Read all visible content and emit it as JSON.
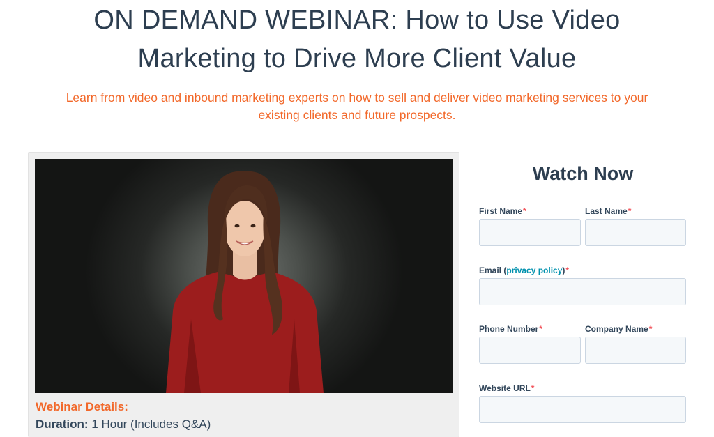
{
  "header": {
    "title_line1": "ON DEMAND WEBINAR: How to Use Video",
    "title_line2": "Marketing to Drive More Client Value",
    "subtitle_line1": "Learn from video and inbound marketing experts on how to sell and deliver video marketing services to your",
    "subtitle_line2": "existing clients and future prospects."
  },
  "webinar": {
    "details_heading": "Webinar Details:",
    "duration_label": "Duration:",
    "duration_value": "1 Hour (Includes Q&A)"
  },
  "form": {
    "title": "Watch Now",
    "required_mark": "*",
    "fields": {
      "first_name": {
        "label": "First Name",
        "value": ""
      },
      "last_name": {
        "label": "Last Name",
        "value": ""
      },
      "email": {
        "label_prefix": "Email (",
        "link_text": "privacy policy",
        "label_suffix": ")",
        "value": ""
      },
      "phone": {
        "label": "Phone Number",
        "value": ""
      },
      "company": {
        "label": "Company Name",
        "value": ""
      },
      "website": {
        "label": "Website URL",
        "value": ""
      }
    }
  },
  "colors": {
    "accent_orange": "#f2682a",
    "heading_navy": "#2d3e50",
    "link_teal": "#0091ae",
    "required_red": "#f2545b",
    "input_bg": "#f5f8fa"
  }
}
